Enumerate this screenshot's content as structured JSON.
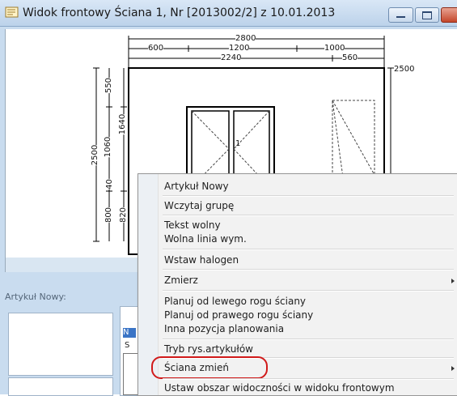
{
  "window": {
    "title": "Widok frontowy Ściana 1, Nr [2013002/2] z 10.01.2013"
  },
  "drawing": {
    "dims_top": {
      "overall": "2800",
      "segments_row1": [
        "600",
        "1200",
        "1000"
      ],
      "segments_row2": [
        "2240",
        "560"
      ]
    },
    "dim_right": "2500",
    "dims_left_outer": "2500",
    "dims_left_row1": [
      "550",
      "1060",
      "800"
    ],
    "dims_left_row2": [
      "1640",
      "820"
    ],
    "dims_left_small": "40",
    "window_label": "1"
  },
  "lower_panel": {
    "label": "Artykuł Nowy:",
    "selected_marker": "N",
    "s_letter": "S"
  },
  "context_menu": {
    "items": [
      "Artykuł Nowy",
      "Wczytaj grupę",
      "Tekst wolny",
      "Wolna linia wym.",
      "Wstaw halogen",
      "Zmierz",
      "Planuj od lewego rogu ściany",
      "Planuj od prawego rogu ściany",
      "Inna pozycja planowania",
      "Tryb rys.artykułów",
      "Ściana zmień",
      "Ustaw obszar widoczności w widoku frontowym"
    ]
  },
  "colors": {
    "highlight": "#d11a1a",
    "window_frame": "#c9dcef"
  }
}
